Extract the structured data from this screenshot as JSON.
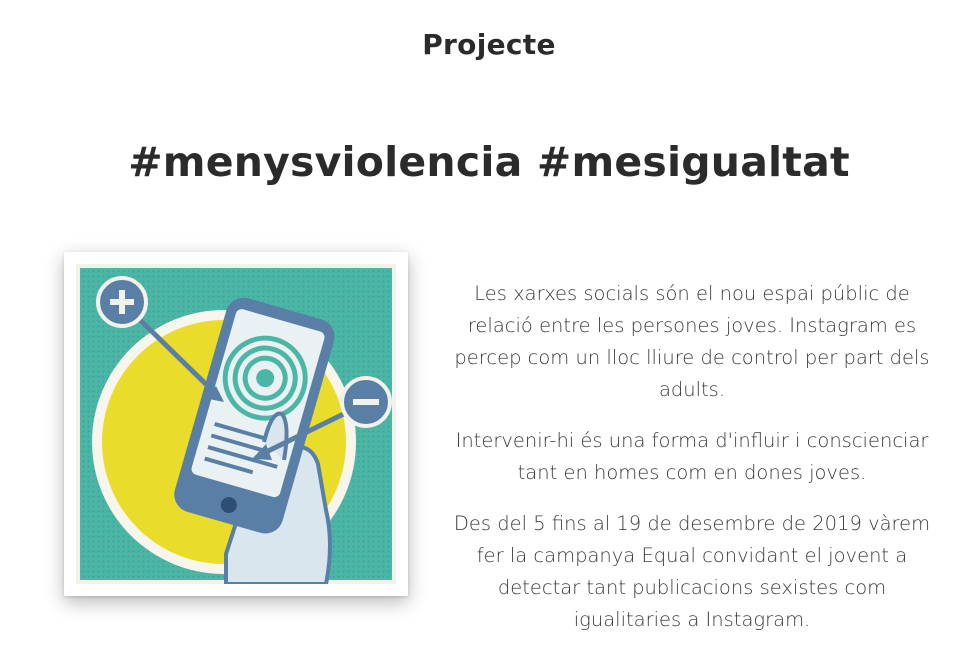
{
  "section": {
    "label": "Projecte"
  },
  "headline": {
    "text": "#menysviolencia #mesigualtat"
  },
  "illustration": {
    "icon_plus": "plus-circle-icon",
    "icon_minus": "minus-circle-icon",
    "colors": {
      "teal": "#4bb6a6",
      "yellow": "#eadc2a",
      "blue": "#5a7fa6",
      "paper": "#f3f2ea"
    }
  },
  "body": {
    "paragraphs": [
      "Les xarxes socials són el nou espai públic de relació entre les persones joves. Instagram es percep com un lloc lliure de control per part dels adults.",
      "Intervenir-hi és una forma d'influir i conscienciar tant en homes com en dones joves.",
      "Des del 5 fins al 19 de desembre de 2019 vàrem fer la campanya Equal convidant el jovent a detectar tant publicacions sexistes com igualitaries a Instagram."
    ]
  }
}
